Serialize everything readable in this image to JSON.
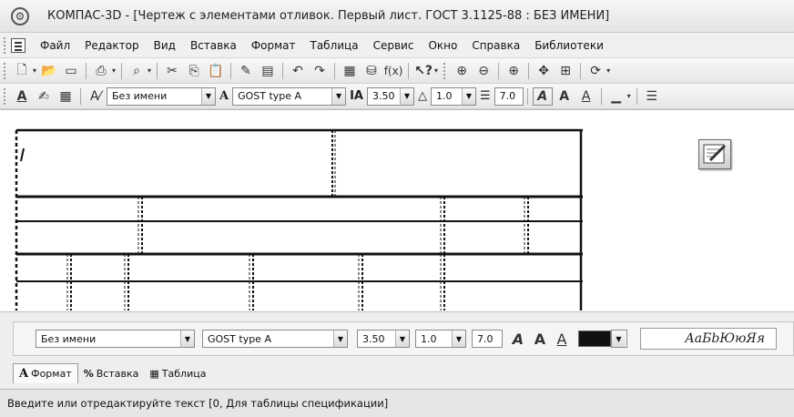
{
  "window": {
    "title": "КОМПАС-3D - [Чертеж с элементами отливок. Первый лист. ГОСТ 3.1125-88 : БЕЗ ИМЕНИ]",
    "app_icon": "kompas-logo-icon"
  },
  "menu": {
    "items": [
      {
        "label": "Файл"
      },
      {
        "label": "Редактор"
      },
      {
        "label": "Вид"
      },
      {
        "label": "Вставка"
      },
      {
        "label": "Формат"
      },
      {
        "label": "Таблица"
      },
      {
        "label": "Сервис"
      },
      {
        "label": "Окно"
      },
      {
        "label": "Справка"
      },
      {
        "label": "Библиотеки"
      }
    ]
  },
  "toolbar_standard": {
    "fx_label": "f(x)",
    "help_label": "?"
  },
  "toolbar_format": {
    "style_value": "Без имени",
    "font_value": "GOST type A",
    "height_value": "3.50",
    "narrowing_value": "1.0",
    "step_value": "7.0"
  },
  "panel": {
    "style_value": "Без имени",
    "font_value": "GOST type A",
    "height_value": "3.50",
    "narrowing_value": "1.0",
    "step_value": "7.0",
    "sample_text": "АаБbЮюЯя",
    "text_color": "#111111",
    "tabs": [
      {
        "label": "Формат",
        "icon": "A"
      },
      {
        "label": "Вставка",
        "icon": "%"
      },
      {
        "label": "Таблица",
        "icon": "table-icon"
      }
    ]
  },
  "status": {
    "text": "Введите или отредактируйте текст [0, Для таблицы спецификации]"
  }
}
